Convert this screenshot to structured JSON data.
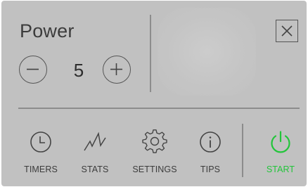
{
  "power": {
    "label": "Power",
    "value": "5"
  },
  "toolbar": {
    "timers_label": "TIMERS",
    "stats_label": "STATS",
    "settings_label": "SETTINGS",
    "tips_label": "TIPS",
    "start_label": "START"
  },
  "icons": {
    "decrease": "minus-circle-icon",
    "increase": "plus-circle-icon",
    "close": "close-box-icon",
    "timers": "clock-icon",
    "stats": "zigzag-graph-icon",
    "settings": "gear-icon",
    "tips": "info-icon",
    "start": "power-icon"
  },
  "colors": {
    "panel_background": "#c1c1c1",
    "text": "#3c3c3c",
    "start_accent": "#22c53a"
  }
}
